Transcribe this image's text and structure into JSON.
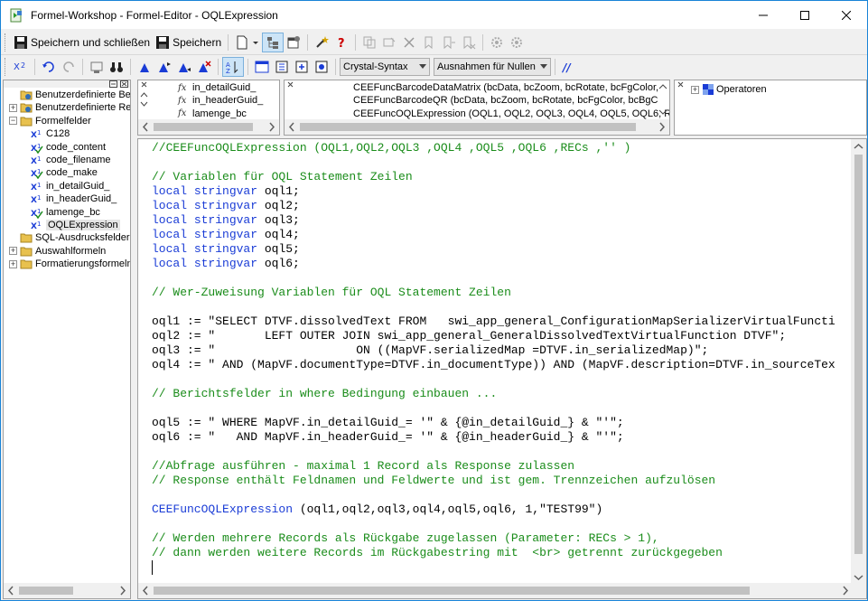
{
  "window": {
    "title": "Formel-Workshop - Formel-Editor - OQLExpression",
    "controls": [
      "minimize",
      "maximize",
      "close"
    ]
  },
  "toolbar1": {
    "save_close": "Speichern und schließen",
    "save": "Speichern"
  },
  "toolbar2": {
    "syntax": "Crystal-Syntax",
    "null_handling": "Ausnahmen für Nullen"
  },
  "tree": {
    "items": [
      {
        "label": "Benutzerdefinierte Ber",
        "level": 0,
        "expander": "",
        "icon": "folder-special-icon"
      },
      {
        "label": "Benutzerdefinierte Re",
        "level": 0,
        "expander": "+",
        "icon": "folder-special-icon"
      },
      {
        "label": "Formelfelder",
        "level": 0,
        "expander": "−",
        "icon": "folder-icon"
      },
      {
        "label": "C128",
        "level": 1,
        "expander": "",
        "icon": "formula-icon"
      },
      {
        "label": "code_content",
        "level": 1,
        "expander": "",
        "icon": "formula-check-icon"
      },
      {
        "label": "code_filename",
        "level": 1,
        "expander": "",
        "icon": "formula-icon"
      },
      {
        "label": "code_make",
        "level": 1,
        "expander": "",
        "icon": "formula-check-icon"
      },
      {
        "label": "in_detailGuid_",
        "level": 1,
        "expander": "",
        "icon": "formula-icon"
      },
      {
        "label": "in_headerGuid_",
        "level": 1,
        "expander": "",
        "icon": "formula-icon"
      },
      {
        "label": "lamenge_bc",
        "level": 1,
        "expander": "",
        "icon": "formula-check-icon"
      },
      {
        "label": "OQLExpression",
        "level": 1,
        "expander": "",
        "icon": "formula-icon",
        "selected": true
      },
      {
        "label": "SQL-Ausdrucksfelder",
        "level": 0,
        "expander": "",
        "icon": "folder-icon"
      },
      {
        "label": "Auswahlformeln",
        "level": 0,
        "expander": "+",
        "icon": "folder-icon"
      },
      {
        "label": "Formatierungsformeln",
        "level": 0,
        "expander": "+",
        "icon": "folder-icon"
      }
    ]
  },
  "fields_panel": {
    "items": [
      "in_detailGuid_",
      "in_headerGuid_",
      "lamenge_bc"
    ]
  },
  "functions_panel": {
    "items": [
      "CEEFuncBarcodeDataMatrix (bcData, bcZoom, bcRotate, bcFgColor,",
      "CEEFuncBarcodeQR (bcData, bcZoom, bcRotate, bcFgColor, bcBgC",
      "CEEFuncOQLExpression (OQL1, OQL2, OQL3, OQL4, OQL5, OQL6, RE"
    ]
  },
  "operators_panel": {
    "items": [
      "Operatoren"
    ]
  },
  "editor": {
    "lines": [
      {
        "t": "cmt",
        "s": "//CEEFuncOQLExpression (OQL1,OQL2,OQL3 ,OQL4 ,OQL5 ,OQL6 ,RECs ,'' )"
      },
      {
        "t": "",
        "s": ""
      },
      {
        "t": "cmt",
        "s": "// Variablen für OQL Statement Zeilen"
      },
      {
        "t": "decl",
        "s": "oql1;"
      },
      {
        "t": "decl",
        "s": "oql2;"
      },
      {
        "t": "decl",
        "s": "oql3;"
      },
      {
        "t": "decl",
        "s": "oql4;"
      },
      {
        "t": "decl",
        "s": "oql5;"
      },
      {
        "t": "decl",
        "s": "oql6;"
      },
      {
        "t": "",
        "s": ""
      },
      {
        "t": "cmt",
        "s": "// Wer-Zuweisung Variablen für OQL Statement Zeilen"
      },
      {
        "t": "",
        "s": ""
      },
      {
        "t": "plain",
        "s": "oql1 := \"SELECT DTVF.dissolvedText FROM   swi_app_general_ConfigurationMapSerializerVirtualFuncti"
      },
      {
        "t": "plain",
        "s": "oql2 := \"       LEFT OUTER JOIN swi_app_general_GeneralDissolvedTextVirtualFunction DTVF\";"
      },
      {
        "t": "plain",
        "s": "oql3 := \"                    ON ((MapVF.serializedMap =DTVF.in_serializedMap)\";"
      },
      {
        "t": "plain",
        "s": "oql4 := \" AND (MapVF.documentType=DTVF.in_documentType)) AND (MapVF.description=DTVF.in_sourceTex"
      },
      {
        "t": "",
        "s": ""
      },
      {
        "t": "cmt",
        "s": "// Berichtsfelder in where Bedingung einbauen ..."
      },
      {
        "t": "",
        "s": ""
      },
      {
        "t": "plain",
        "s": "oql5 := \" WHERE MapVF.in_detailGuid_= '\" & {@in_detailGuid_} & \"'\";"
      },
      {
        "t": "plain",
        "s": "oql6 := \"   AND MapVF.in_headerGuid_= '\" & {@in_headerGuid_} & \"'\";"
      },
      {
        "t": "",
        "s": ""
      },
      {
        "t": "cmt",
        "s": "//Abfrage ausführen - maximal 1 Record als Response zulassen"
      },
      {
        "t": "cmt",
        "s": "// Response enthält Feldnamen und Feldwerte und ist gem. Trennzeichen aufzulösen"
      },
      {
        "t": "",
        "s": ""
      },
      {
        "t": "call",
        "s": " (oql1,oql2,oql3,oql4,oql5,oql6, 1,\"TEST99\")"
      },
      {
        "t": "",
        "s": ""
      },
      {
        "t": "cmt",
        "s": "// Werden mehrere Records als Rückgabe zugelassen (Parameter: RECs > 1),"
      },
      {
        "t": "cmt",
        "s": "// dann werden weitere Records im Rückgabestring mit  <br> getrennt zurückgegeben"
      }
    ],
    "keyword_local": "local",
    "keyword_type": "stringvar",
    "function_name": "CEEFuncOQLExpression"
  },
  "colors": {
    "comment": "#1a8c1a",
    "keyword": "#1a3cd6",
    "selection": "#cce8ff"
  }
}
